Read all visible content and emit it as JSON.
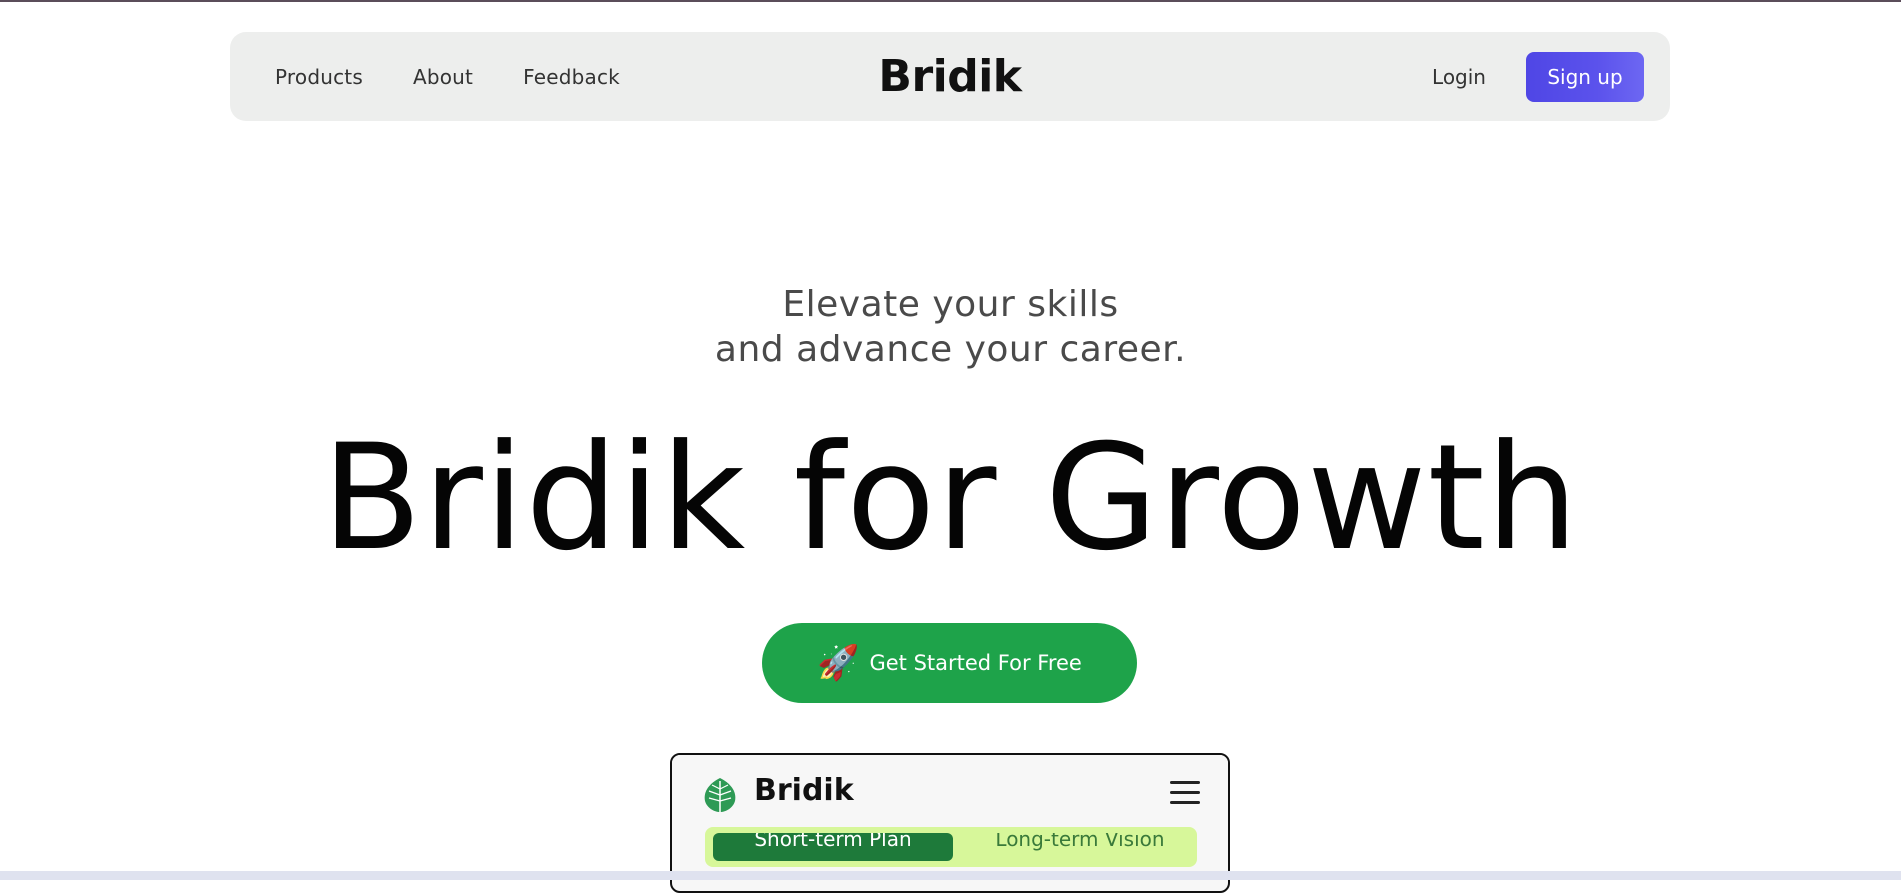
{
  "nav": {
    "links": [
      "Products",
      "About",
      "Feedback"
    ],
    "logo": "Bridik",
    "login_label": "Login",
    "signup_label": "Sign up"
  },
  "hero": {
    "subtitle_line1": "Elevate your skills",
    "subtitle_line2": "and advance your career.",
    "title": "Bridik for Growth",
    "cta_icon": "🚀",
    "cta_label": "Get Started For Free"
  },
  "preview": {
    "brand": "Bridik",
    "tabs": [
      "Short-term Plan",
      "Long-term Vision"
    ]
  },
  "colors": {
    "signup": "#4f46e5",
    "cta": "#1ea34a",
    "tab_active": "#1e7a3a",
    "tabs_bg": "#d7f79a"
  }
}
